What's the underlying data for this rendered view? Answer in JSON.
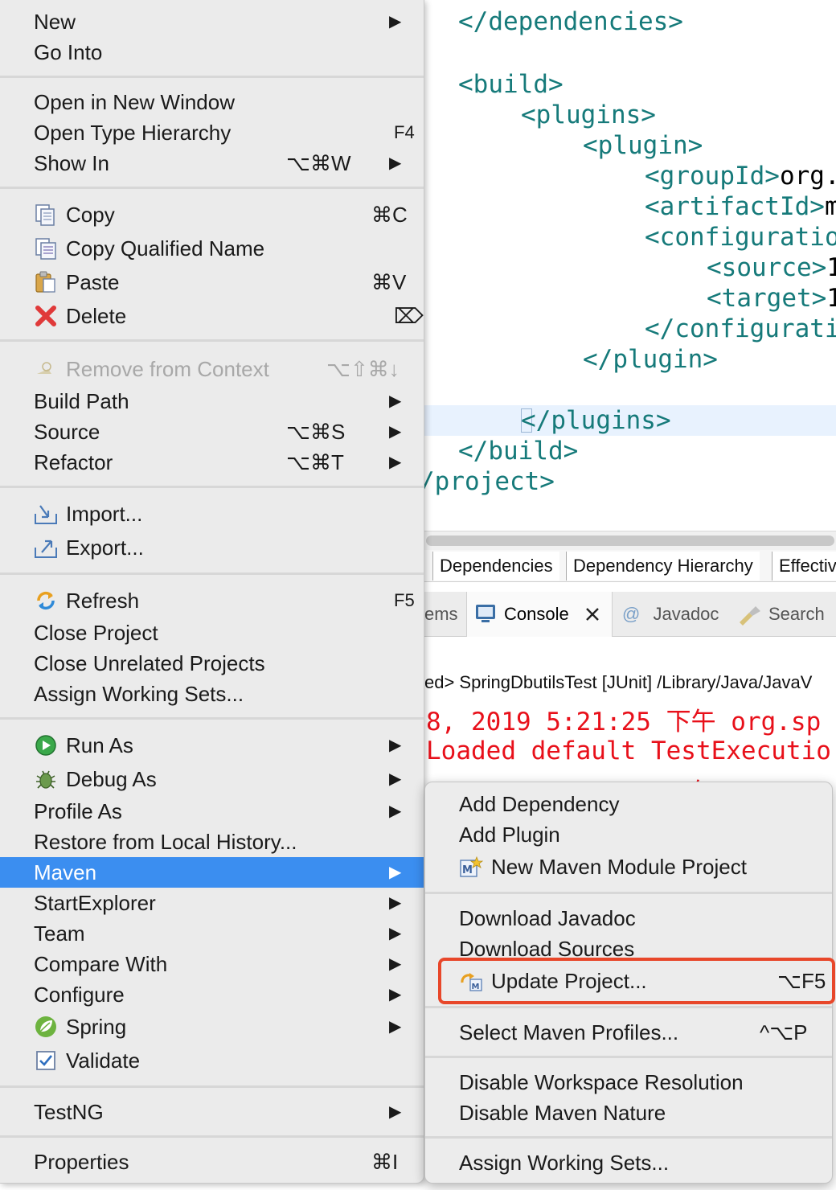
{
  "editor": {
    "lines": [
      {
        "tag": "</dependencies>",
        "text": ""
      },
      {
        "tag": "<build>",
        "text": ""
      },
      {
        "tag": "<plugins>",
        "text": ""
      },
      {
        "tag": "<plugin>",
        "text": ""
      },
      {
        "tag": "<groupId>",
        "text": "org."
      },
      {
        "tag": "<artifactId>",
        "text": "m"
      },
      {
        "tag": "<configuratio",
        "text": ""
      },
      {
        "tag": "<source>",
        "text": "1"
      },
      {
        "tag": "<target>",
        "text": "1"
      },
      {
        "tag": "</configurati",
        "text": ""
      },
      {
        "tag": "</plugin>",
        "text": ""
      },
      {
        "tag": "</plugins>",
        "text": ""
      },
      {
        "tag": "</build>",
        "text": ""
      },
      {
        "tag": "/project>",
        "text": ""
      }
    ]
  },
  "pom_tabs": [
    "Dependencies",
    "Dependency Hierarchy",
    "Effectiv"
  ],
  "view_tabs": {
    "problems": "ems",
    "console": "Console",
    "javadoc": "Javadoc",
    "search": "Search"
  },
  "console": {
    "header": "ed> SpringDbutilsTest [JUnit] /Library/Java/JavaV",
    "log_lines": [
      "8, 2019 5:21:25 下午 org.sp",
      "Loaded default TestExecutio",
      "9, 2019 5:21:25 下午 org.s"
    ]
  },
  "context_menu": {
    "new": {
      "label": "New"
    },
    "go_into": {
      "label": "Go Into"
    },
    "open_new_window": {
      "label": "Open in New Window"
    },
    "open_type_hierarchy": {
      "label": "Open Type Hierarchy",
      "shortcut": "F4"
    },
    "show_in": {
      "label": "Show In",
      "shortcut": "⌥⌘W"
    },
    "copy": {
      "label": "Copy",
      "shortcut": "⌘C"
    },
    "copy_qualified": {
      "label": "Copy Qualified Name"
    },
    "paste": {
      "label": "Paste",
      "shortcut": "⌘V"
    },
    "delete": {
      "label": "Delete",
      "shortcut": "⌦"
    },
    "remove_context": {
      "label": "Remove from Context",
      "shortcut": "⌥⇧⌘↓"
    },
    "build_path": {
      "label": "Build Path"
    },
    "source": {
      "label": "Source",
      "shortcut": "⌥⌘S"
    },
    "refactor": {
      "label": "Refactor",
      "shortcut": "⌥⌘T"
    },
    "import": {
      "label": "Import..."
    },
    "export": {
      "label": "Export..."
    },
    "refresh": {
      "label": "Refresh",
      "shortcut": "F5"
    },
    "close_project": {
      "label": "Close Project"
    },
    "close_unrelated": {
      "label": "Close Unrelated Projects"
    },
    "assign_sets": {
      "label": "Assign Working Sets..."
    },
    "run_as": {
      "label": "Run As"
    },
    "debug_as": {
      "label": "Debug As"
    },
    "profile_as": {
      "label": "Profile As"
    },
    "restore_history": {
      "label": "Restore from Local History..."
    },
    "maven": {
      "label": "Maven"
    },
    "startexplorer": {
      "label": "StartExplorer"
    },
    "team": {
      "label": "Team"
    },
    "compare_with": {
      "label": "Compare With"
    },
    "configure": {
      "label": "Configure"
    },
    "spring": {
      "label": "Spring"
    },
    "validate": {
      "label": "Validate"
    },
    "testng": {
      "label": "TestNG"
    },
    "properties": {
      "label": "Properties",
      "shortcut": "⌘I"
    }
  },
  "maven_submenu": {
    "add_dependency": {
      "label": "Add Dependency"
    },
    "add_plugin": {
      "label": "Add Plugin"
    },
    "new_module": {
      "label": "New Maven Module Project"
    },
    "download_javadoc": {
      "label": "Download Javadoc"
    },
    "download_sources": {
      "label": "Download Sources"
    },
    "update_project": {
      "label": "Update Project...",
      "shortcut": "⌥F5"
    },
    "select_profiles": {
      "label": "Select Maven Profiles...",
      "shortcut": "^⌥P"
    },
    "disable_workspace": {
      "label": "Disable Workspace Resolution"
    },
    "disable_nature": {
      "label": "Disable Maven Nature"
    },
    "assign_sets": {
      "label": "Assign Working Sets..."
    }
  },
  "submenu_arrow": "▶",
  "colors": {
    "xml_tag": "#167a7a",
    "menu_selected": "#3b8ef0",
    "console_error": "#e8101a",
    "highlight_box": "#e8472a"
  }
}
